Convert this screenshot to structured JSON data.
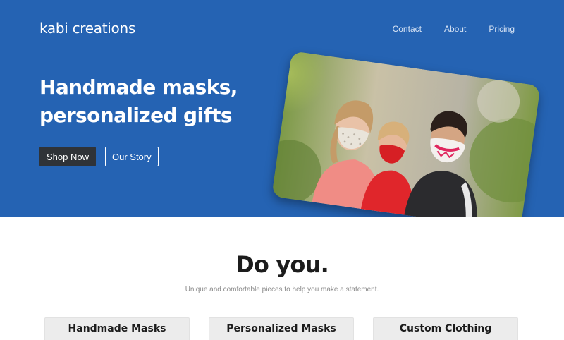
{
  "header": {
    "brand": "kabi creations",
    "nav": [
      "Contact",
      "About",
      "Pricing"
    ]
  },
  "hero": {
    "headline_line1": "Handmade masks,",
    "headline_line2": "personalized gifts",
    "primary_button": "Shop Now",
    "secondary_button": "Our Story",
    "image_subject": "family-wearing-face-masks"
  },
  "section": {
    "title": "Do you.",
    "subtitle": "Unique and comfortable pieces to help you make a statement.",
    "cards": [
      "Handmade Masks",
      "Personalized Masks",
      "Custom Clothing"
    ]
  },
  "colors": {
    "hero_background": "#2563b3",
    "dark_button": "#2f3338",
    "card_background": "#ececec"
  }
}
